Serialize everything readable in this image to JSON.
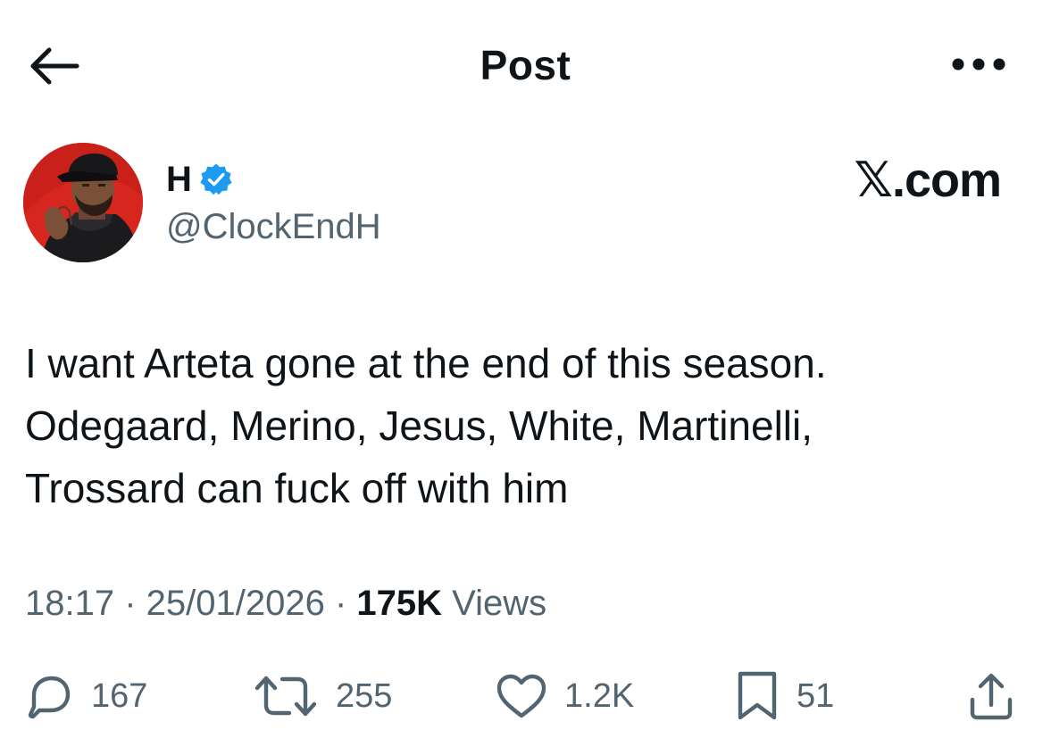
{
  "header": {
    "title": "Post",
    "back_icon": "arrow-left-icon",
    "more_icon": "more-horizontal-icon"
  },
  "author": {
    "name": "H",
    "handle": "@ClockEndH",
    "verified": true,
    "verified_color": "#1d9bf0",
    "avatar_background": "#d7261e"
  },
  "brand": {
    "text": "𝕏.com"
  },
  "tweet": {
    "text": "I want Arteta gone at the end of this season.\nOdegaard, Merino, Jesus, White, Martinelli,\nTrossard can fuck off with him"
  },
  "meta": {
    "time": "18:17",
    "separator": " · ",
    "date": "25/01/2026",
    "views_count": "175K",
    "views_label": " Views"
  },
  "actions": {
    "replies": "167",
    "reposts": "255",
    "likes": "1.2K",
    "bookmarks": "51"
  },
  "colors": {
    "text_primary": "#0f1419",
    "text_secondary": "#536471"
  }
}
